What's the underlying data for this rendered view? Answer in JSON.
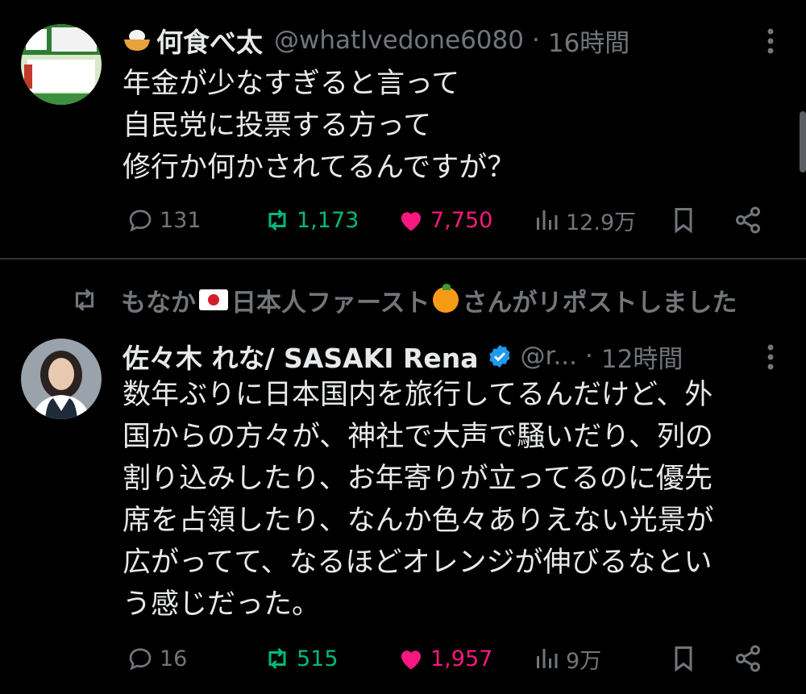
{
  "tweet1": {
    "name": "何食べ太",
    "handle": "@whatIvedone6080",
    "dot": "·",
    "time": "16時間",
    "body": "年金が少なすぎると言って\n自民党に投票する方って\n修行か何かされてるんですが？",
    "stats": {
      "replies": "131",
      "reposts": "1,173",
      "likes": "7,750",
      "views": "12.9万"
    },
    "liked": true
  },
  "repost_banner": {
    "text_before": "もなか",
    "text_middle": "日本人ファースト",
    "text_after": "さんがリポストしました"
  },
  "tweet2": {
    "name": "佐々木 れな/ SASAKI Rena",
    "handle": "@r...",
    "dot": "·",
    "time": "12時間",
    "body": "数年ぶりに日本国内を旅行してるんだけど、外\n国からの方々が、神社で大声で騒いだり、列の\n割り込みしたり、お年寄りが立ってるのに優先\n席を占領したり、なんか色々ありえない光景が\n広がってて、なるほどオレンジが伸びるなとい\nう感じだった。",
    "stats": {
      "replies": "16",
      "reposts": "515",
      "likes": "1,957",
      "views": "9万"
    },
    "liked": true,
    "verified": true
  },
  "colors": {
    "background": "#000000",
    "text": "#e7e9ea",
    "muted": "#71767b",
    "repost": "#00ba7c",
    "like": "#f91880",
    "verified": "#1d9bf0"
  },
  "icons": [
    "reply-icon",
    "repost-icon",
    "heart-icon",
    "views-icon",
    "bookmark-icon",
    "share-icon",
    "more-icon",
    "verified-icon"
  ]
}
